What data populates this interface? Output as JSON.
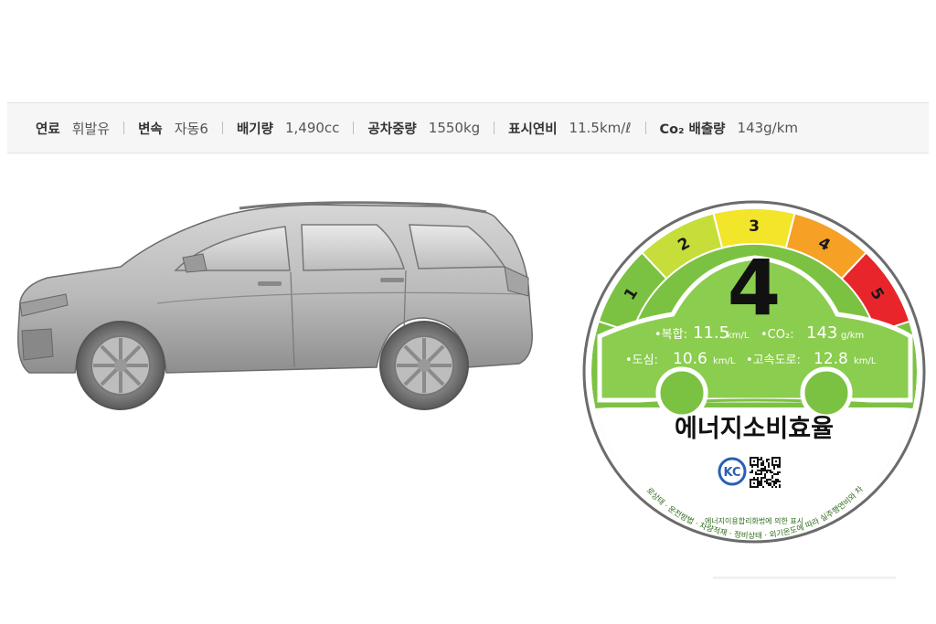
{
  "specs": [
    {
      "label": "연료",
      "value": "휘발유"
    },
    {
      "label": "변속",
      "value": "자동6"
    },
    {
      "label": "배기량",
      "value": "1,490cc"
    },
    {
      "label": "공차중량",
      "value": "1550kg"
    },
    {
      "label": "표시연비",
      "value": "11.5km/ℓ"
    },
    {
      "label": "Co₂ 배출량",
      "value": "143g/km"
    }
  ],
  "energy_label": {
    "grade": "4",
    "scale": [
      "1",
      "2",
      "3",
      "4",
      "5"
    ],
    "scale_colors": [
      "#7cc242",
      "#c6dd3a",
      "#f3e52a",
      "#f6a126",
      "#e8252a"
    ],
    "combined_label": "•복합:",
    "combined_value": "11.5",
    "combined_unit": "km/L",
    "co2_label": "•CO₂:",
    "co2_value": "143",
    "co2_unit": "g/km",
    "city_label": "•도심:",
    "city_value": "10.6",
    "city_unit": "km/L",
    "highway_label": "•고속도로:",
    "highway_value": "12.8",
    "highway_unit": "km/L",
    "title": "에너지소비효율",
    "disclaimer": "※ 위 연비는 도로상태 · 운전방법 · 차량적재 · 정비상태 · 외기온도에 따라 실주행연비와 차이가 있습니다.",
    "footer": "에너지이용합리화법에 의한 표시",
    "cert_mark": "KC"
  }
}
